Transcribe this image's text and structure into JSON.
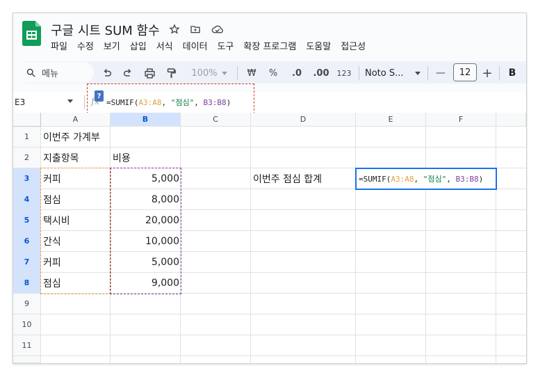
{
  "document": {
    "title": "구글 시트 SUM 함수"
  },
  "title_icons": [
    "star-icon",
    "move-folder-icon",
    "cloud-status-icon"
  ],
  "menu": [
    "파일",
    "수정",
    "보기",
    "삽입",
    "서식",
    "데이터",
    "도구",
    "확장 프로그램",
    "도움말",
    "접근성"
  ],
  "toolbar": {
    "search_label": "메뉴",
    "zoom": "100%",
    "currency": "₩",
    "percent": "%",
    "dec_decrease": ".0",
    "dec_increase": ".00",
    "number_format": "123",
    "font": "Noto S...",
    "minus": "—",
    "font_size": "12",
    "plus": "+",
    "bold": "B"
  },
  "formula_bar": {
    "name_box": "E3",
    "fx": "fx",
    "help": "?",
    "formula": {
      "prefix": "=SUMIF(",
      "range_a": "A3:A8",
      "sep1": ", ",
      "criterion": "\"점심\"",
      "sep2": ", ",
      "range_b": "B3:B8",
      "suffix": ")"
    }
  },
  "columns": [
    "A",
    "B",
    "C",
    "D",
    "E",
    "F"
  ],
  "rows": [
    "1",
    "2",
    "3",
    "4",
    "5",
    "6",
    "7",
    "8",
    "9",
    "10",
    "11"
  ],
  "cells": {
    "A1": "이번주 가계부",
    "A2": "지출항목",
    "B2": "비용",
    "A3": "커피",
    "B3": "5,000",
    "A4": "점심",
    "B4": "8,000",
    "A5": "택시비",
    "B5": "20,000",
    "A6": "간식",
    "B6": "10,000",
    "A7": "커피",
    "B7": "5,000",
    "A8": "점심",
    "B8": "9,000",
    "D3": "이번주 점심 합계"
  },
  "colors": {
    "range_a": "#e1a33e",
    "range_b": "#7e3f98",
    "string": "#0b8043",
    "active": "#1a73e8",
    "annotation": "#d93025"
  }
}
